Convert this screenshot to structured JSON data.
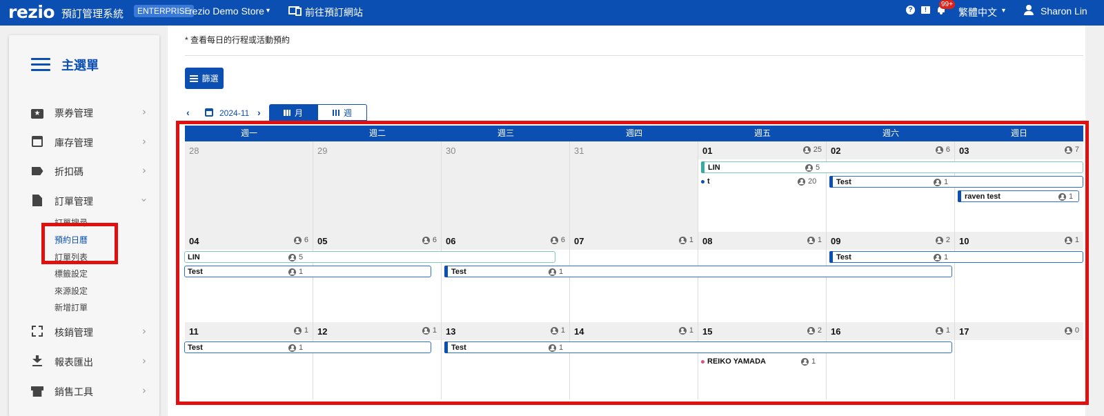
{
  "topbar": {
    "logo": "rezio",
    "app_title": "預訂管理系統",
    "plan_badge": "ENTERPRISE",
    "store_name": "rezio Demo Store",
    "goto_site": "前往預訂網站",
    "notification_count": "99+",
    "language": "繁體中文",
    "user_name": "Sharon Lin",
    "icons": [
      "help-icon",
      "feedback-icon",
      "bell-icon",
      "user-icon"
    ]
  },
  "sidebar": {
    "title": "主選單",
    "items": [
      {
        "label": "票券管理",
        "icon": "ticket-star-icon"
      },
      {
        "label": "庫存管理",
        "icon": "calendar-icon"
      },
      {
        "label": "折扣碼",
        "icon": "tag-icon"
      },
      {
        "label": "訂單管理",
        "icon": "document-icon"
      },
      {
        "label": "核銷管理",
        "icon": "scan-icon"
      },
      {
        "label": "報表匯出",
        "icon": "download-icon"
      },
      {
        "label": "銷售工具",
        "icon": "store-icon"
      }
    ],
    "order_sub": [
      "訂單搜尋",
      "預約日曆",
      "訂單列表",
      "標籤設定",
      "來源設定",
      "新增訂單"
    ]
  },
  "main": {
    "hint": "* 查看每日的行程或活動預約",
    "filter_label": "篩選",
    "month": "2024-11",
    "view_month": "月",
    "view_week": "週"
  },
  "calendar": {
    "weekdays": [
      "週一",
      "週二",
      "週三",
      "週四",
      "週五",
      "週六",
      "週日"
    ],
    "weeks": [
      [
        {
          "day": "28",
          "count": ""
        },
        {
          "day": "29",
          "count": ""
        },
        {
          "day": "30",
          "count": ""
        },
        {
          "day": "31",
          "count": ""
        },
        {
          "day": "01",
          "count": "25"
        },
        {
          "day": "02",
          "count": "6"
        },
        {
          "day": "03",
          "count": "7"
        }
      ],
      [
        {
          "day": "04",
          "count": "6"
        },
        {
          "day": "05",
          "count": "6"
        },
        {
          "day": "06",
          "count": "6"
        },
        {
          "day": "07",
          "count": "1"
        },
        {
          "day": "08",
          "count": "1"
        },
        {
          "day": "09",
          "count": "2"
        },
        {
          "day": "10",
          "count": "1"
        }
      ],
      [
        {
          "day": "11",
          "count": "1"
        },
        {
          "day": "12",
          "count": "1"
        },
        {
          "day": "13",
          "count": "1"
        },
        {
          "day": "14",
          "count": "1"
        },
        {
          "day": "15",
          "count": "2"
        },
        {
          "day": "16",
          "count": "1"
        },
        {
          "day": "17",
          "count": "0"
        }
      ]
    ],
    "events": [
      {
        "title": "LIN",
        "count": "5"
      },
      {
        "title": "t",
        "count": "20"
      },
      {
        "title": "Test",
        "count": "1"
      },
      {
        "title": "raven test",
        "count": "1"
      },
      {
        "title": "LIN",
        "count": "5"
      },
      {
        "title": "Test",
        "count": "1"
      },
      {
        "title": "Test",
        "count": "1"
      },
      {
        "title": "Test",
        "count": "1"
      },
      {
        "title": "Test",
        "count": "1"
      },
      {
        "title": "Test",
        "count": "1"
      },
      {
        "title": "REIKO YAMADA",
        "count": "1"
      }
    ]
  }
}
